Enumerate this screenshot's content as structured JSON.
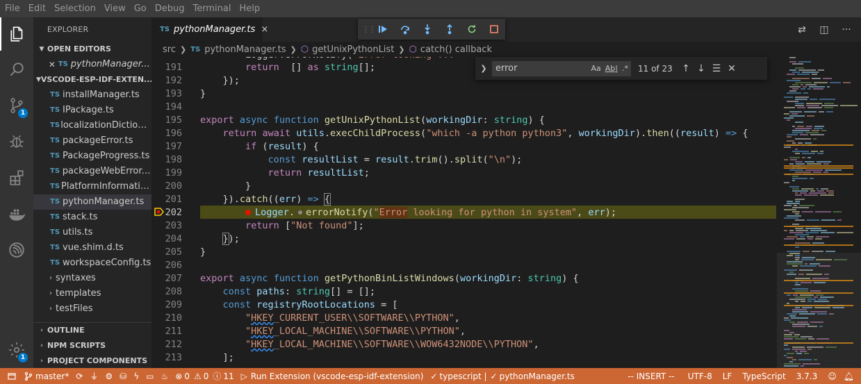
{
  "menu": [
    "File",
    "Edit",
    "Selection",
    "View",
    "Go",
    "Debug",
    "Terminal",
    "Help"
  ],
  "activity_bar": {
    "scm_badge": "1",
    "settings_badge": "1"
  },
  "sidebar": {
    "title": "EXPLORER",
    "open_editors_label": "OPEN EDITORS",
    "open_editor_file": "pythonManager.ts",
    "workspace_label": "VSCODE-ESP-IDF-EXTEN...",
    "files": [
      "installManager.ts",
      "IPackage.ts",
      "localizationDictionary.ts",
      "packageError.ts",
      "PackageProgress.ts",
      "packageWebError.ts",
      "PlatformInformation.ts",
      "pythonManager.ts",
      "stack.ts",
      "utils.ts",
      "vue.shim.d.ts",
      "workspaceConfig.ts"
    ],
    "folders": [
      "syntaxes",
      "templates",
      "testFiles"
    ],
    "outline_label": "OUTLINE",
    "npm_scripts_label": "NPM SCRIPTS",
    "project_components_label": "PROJECT COMPONENTS",
    "file_type_badge": "TS"
  },
  "tab": {
    "badge": "TS",
    "name": "pythonManager.ts",
    "close": "×"
  },
  "breadcrumb": {
    "folder": "src",
    "file": "pythonManager.ts",
    "symbol1": "getUnixPythonList",
    "symbol2": "catch() callback"
  },
  "find": {
    "query": "error",
    "match_case": "Aa",
    "whole_word": "Ab|",
    "regex": ".*",
    "count": "11 of 23"
  },
  "editor": {
    "line_numbers": [
      "191",
      "192",
      "193",
      "194",
      "195",
      "196",
      "197",
      "198",
      "199",
      "200",
      "201",
      "202",
      "203",
      "204",
      "205",
      "206",
      "207",
      "208",
      "209",
      "210",
      "211",
      "212",
      "213"
    ],
    "current_line": "202"
  },
  "statusbar": {
    "branch": "master*",
    "errors": "0",
    "warnings": "0",
    "info": "11",
    "launch": "Run Extension (vscode-esp-idf-extension)",
    "lang_check": "typescript |",
    "file_check": "pythonManager.ts",
    "mode": "-- INSERT --",
    "encoding": "UTF-8",
    "eol": "LF",
    "language": "TypeScript",
    "version": "3.7.3"
  },
  "colors": {
    "statusbar": "#cc6633",
    "accent": "#007acc",
    "highlight_line": "#4b4b18"
  }
}
